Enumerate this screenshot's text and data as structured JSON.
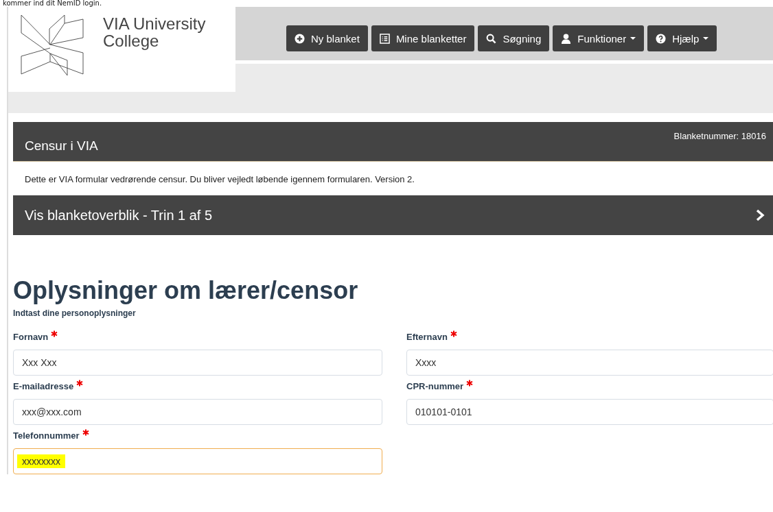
{
  "top_caption": "kommer ind dit NemID login.",
  "logo": {
    "name_lines": [
      "VIA University",
      "College"
    ]
  },
  "nav": [
    {
      "label": "Ny blanket",
      "dropdown": false
    },
    {
      "label": "Mine blanketter",
      "dropdown": false
    },
    {
      "label": "Søgning",
      "dropdown": false
    },
    {
      "label": "Funktioner",
      "dropdown": true
    },
    {
      "label": "Hjælp",
      "dropdown": true
    }
  ],
  "form_header": {
    "title": "Censur i VIA",
    "number": "Blanketnummer: 18016"
  },
  "description": "Dette er VIA formular vedrørende censur. Du bliver vejledt løbende igennem formularen. Version 2.",
  "steps_bar": {
    "label": "Vis blanketoverblik - Trin 1 af 5",
    "expanded": false
  },
  "section": {
    "title": "Oplysninger om lærer/censor",
    "subtitle": "Indtast dine personoplysninger"
  },
  "fields": [
    {
      "label": "Fornavn",
      "value": "Xxx Xxx",
      "required": true,
      "focused": false
    },
    {
      "label": "Efternavn",
      "value": "Xxxx",
      "required": true,
      "focused": false
    },
    {
      "label": "E-mailadresse",
      "value": "xxx@xxx.com",
      "required": true,
      "focused": false
    },
    {
      "label": "CPR-nummer",
      "value": "010101-0101",
      "required": true,
      "focused": false
    },
    {
      "label": "Telefonnummer",
      "value": "xxxxxxxx",
      "required": true,
      "focused": true
    }
  ]
}
